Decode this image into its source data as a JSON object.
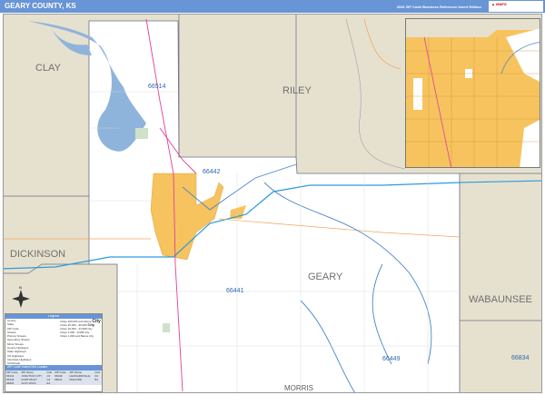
{
  "header": {
    "title": "GEARY COUNTY, KS",
    "edition": "2026 ZIP Code Business Reference Insert Edition",
    "logo_text": "Market MAPS"
  },
  "colors": {
    "header": "#6795d6",
    "outside": "#e6e1cf",
    "county": "#ffffff",
    "city": "#f7c35e",
    "water": "#8fb4dc",
    "zip_boundary": "#4a86c8",
    "interstate": "#2c9bd9",
    "us_highway": "#e0409a",
    "state_highway": "#f0a560"
  },
  "counties": {
    "clay": "CLAY",
    "riley": "RILEY",
    "dickinson": "DICKINSON",
    "geary": "GEARY",
    "wabaunsee": "WABAUNSEE",
    "morris": "MORRIS"
  },
  "zips": {
    "z66514": "66514",
    "z66442": "66442",
    "z66441": "66441",
    "z66449": "66449",
    "z66834": "66834"
  },
  "legend": {
    "title": "Legend",
    "items": [
      "County",
      "State",
      "ZIP Code",
      "Streets",
      "Primary Streets",
      "Secondary Streets",
      "Minor Streets",
      "County Highways",
      "State Highways",
      "US Highways",
      "Interstate Highways",
      "Toll Roads"
    ],
    "populations": [
      "Cities 100,000 and Above",
      "Cities 25,000 - 99,999",
      "Cities 10,000 - 24,999",
      "Cities 1,000 - 9,999",
      "Cities 1,000 and Below"
    ],
    "city_samples": [
      "City",
      "City",
      "City",
      "City",
      "City"
    ]
  },
  "index": {
    "title": "ZIP Code Index/Grid Locator",
    "headers": [
      "ZIP Code",
      "ZIP Name",
      "Grid",
      "ZIP Code",
      "ZIP Name",
      "Grid"
    ],
    "rows": [
      [
        "66441",
        "JUNCTION CITY",
        "C3",
        "66449",
        "LEONARDVILLE",
        "D1"
      ],
      [
        "66442",
        "FORT RILEY",
        "C2",
        "66514",
        "MILFORD",
        "B1"
      ],
      [
        "66834",
        "ALTA VISTA",
        "E4",
        "",
        "",
        ""
      ]
    ]
  },
  "compass": "N"
}
